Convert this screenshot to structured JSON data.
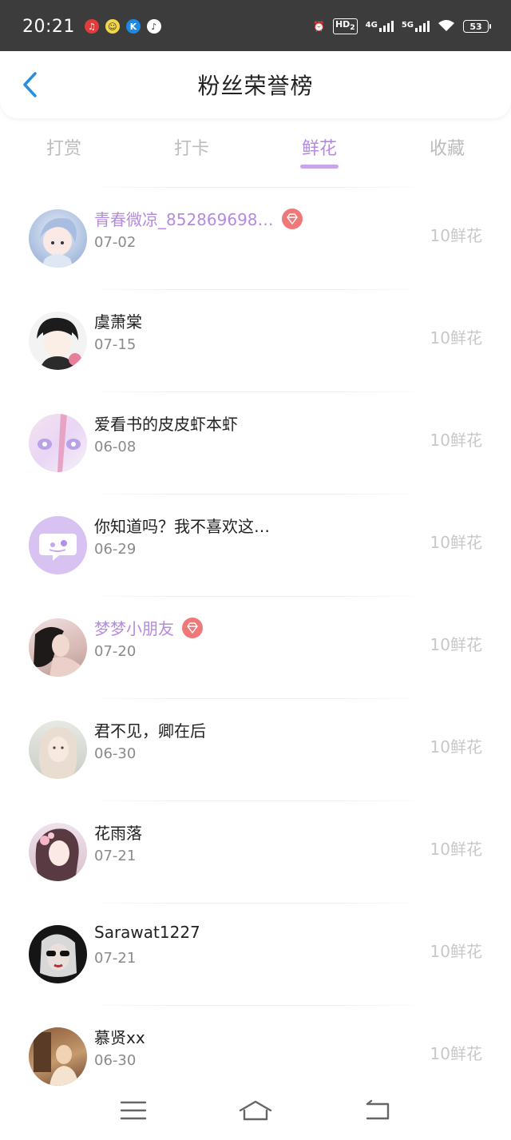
{
  "status_bar": {
    "time": "20:21",
    "hd": "HD",
    "hd_sub": "2",
    "net1": "4G",
    "net2": "5G",
    "battery": "53"
  },
  "header": {
    "title": "粉丝荣誉榜"
  },
  "tabs": [
    {
      "label": "打赏"
    },
    {
      "label": "打卡"
    },
    {
      "label": "鲜花",
      "active": true
    },
    {
      "label": "收藏"
    }
  ],
  "list": [
    {
      "name": "青春微凉_852869698…",
      "date": "07-02",
      "amount": "10鲜花",
      "vip": true
    },
    {
      "name": "虞萧棠",
      "date": "07-15",
      "amount": "10鲜花",
      "vip": false
    },
    {
      "name": "爱看书的皮皮虾本虾",
      "date": "06-08",
      "amount": "10鲜花",
      "vip": false
    },
    {
      "name": "你知道吗？我不喜欢这…",
      "date": "06-29",
      "amount": "10鲜花",
      "vip": false
    },
    {
      "name": "梦梦小朋友",
      "date": "07-20",
      "amount": "10鲜花",
      "vip": true
    },
    {
      "name": "君不见，卿在后",
      "date": "06-30",
      "amount": "10鲜花",
      "vip": false
    },
    {
      "name": "花雨落",
      "date": "07-21",
      "amount": "10鲜花",
      "vip": false
    },
    {
      "name": "Sarawat1227",
      "date": "07-21",
      "amount": "10鲜花",
      "vip": false
    },
    {
      "name": "慕贤xx",
      "date": "06-30",
      "amount": "10鲜花",
      "vip": false
    }
  ],
  "colors": {
    "accent": "#b58ae0",
    "vip_badge": "#ef7878",
    "muted": "#c8c8c8"
  }
}
